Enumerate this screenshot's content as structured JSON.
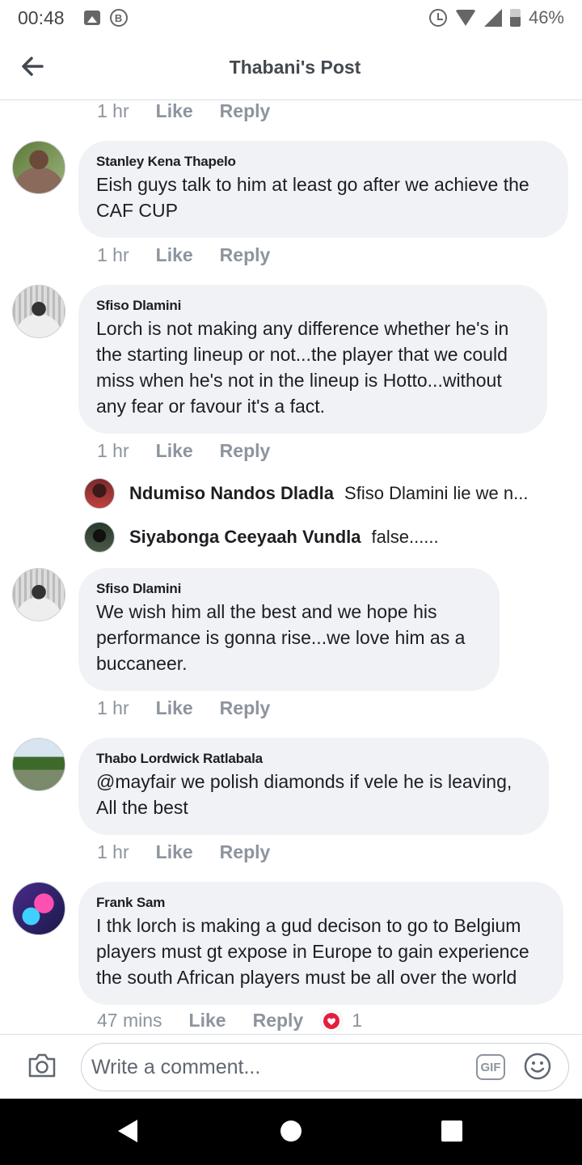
{
  "status_bar": {
    "time": "00:48",
    "battery": "46%",
    "icons": [
      "image-icon",
      "b-icon",
      "alarm-icon",
      "wifi-icon",
      "signal-icon",
      "battery-icon"
    ]
  },
  "header": {
    "title": "Thabani's Post",
    "back_icon": "arrow-left-icon"
  },
  "top_actions": {
    "time": "1 hr",
    "like": "Like",
    "reply": "Reply"
  },
  "comments": [
    {
      "author": "Stanley Kena Thapelo",
      "text": "Eish guys talk to him at least go after we achieve the CAF CUP",
      "time": "1 hr",
      "like": "Like",
      "reply": "Reply"
    },
    {
      "author": "Sfiso Dlamini",
      "text": "Lorch is not making any difference whether he's in the starting lineup or not...the player that we could miss when he's not in the lineup is Hotto...without any fear or favour it's a fact.",
      "time": "1 hr",
      "like": "Like",
      "reply": "Reply",
      "replies": [
        {
          "author": "Ndumiso Nandos Dladla",
          "text": "Sfiso Dlamini lie we n..."
        },
        {
          "author": "Siyabonga Ceeyaah Vundla",
          "text": "false......"
        }
      ]
    },
    {
      "author": "Sfiso Dlamini",
      "text": "We wish him all the best and we hope his performance is gonna rise...we love him as a buccaneer.",
      "time": "1 hr",
      "like": "Like",
      "reply": "Reply"
    },
    {
      "author": "Thabo Lordwick Ratlabala",
      "text": "@mayfair we polish diamonds if vele he is leaving, All the best",
      "time": "1 hr",
      "like": "Like",
      "reply": "Reply"
    },
    {
      "author": "Frank Sam",
      "text": "I thk lorch is making a gud decison to go to Belgium players must gt expose in Europe to gain experience the south African players must be all over the world",
      "time": "47 mins",
      "like": "Like",
      "reply": "Reply",
      "reaction_count": "1",
      "reaction_icon": "heart-icon"
    }
  ],
  "composer": {
    "placeholder": "Write a comment...",
    "gif_label": "GIF",
    "camera_icon": "camera-icon",
    "emoji_icon": "emoji-icon"
  },
  "colors": {
    "bubble": "#f0f2f5",
    "meta_text": "#8d949e",
    "heart": "#e41e3f"
  }
}
